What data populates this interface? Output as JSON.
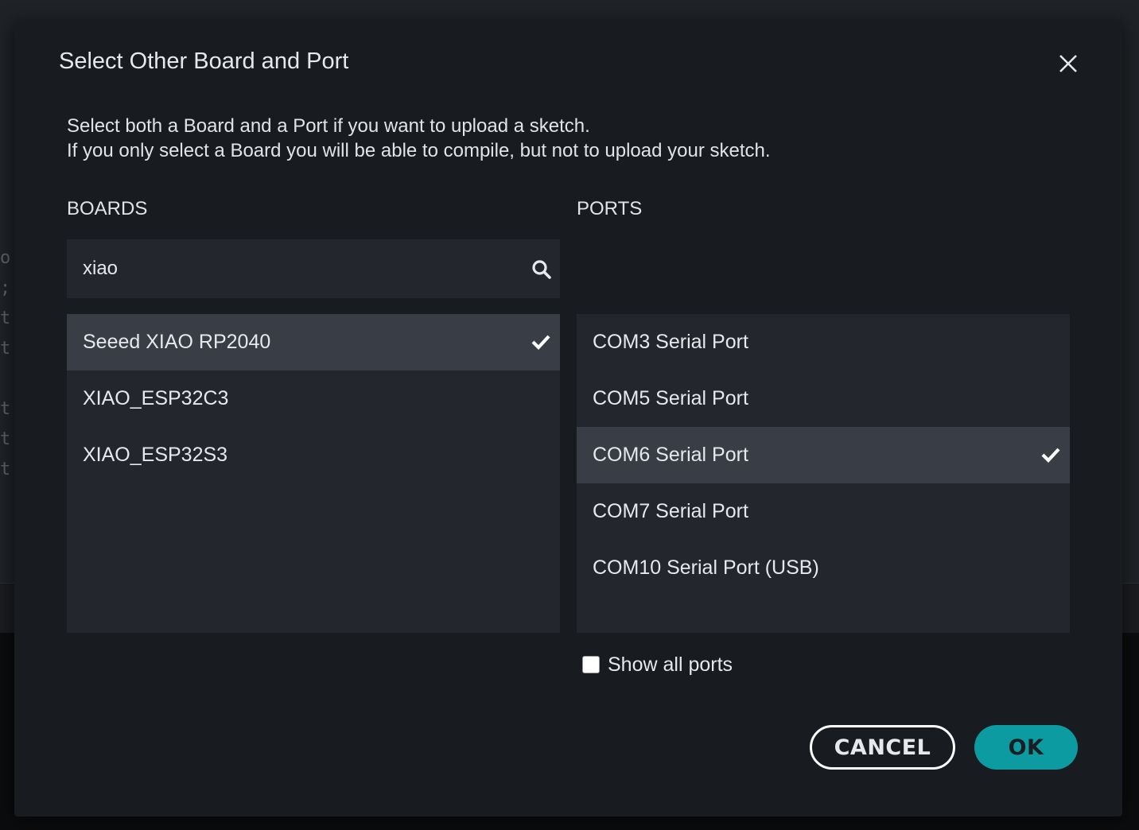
{
  "dialog": {
    "title": "Select Other Board and Port",
    "intro_line1": "Select both a Board and a Port if you want to upload a sketch.",
    "intro_line2": "If you only select a Board you will be able to compile, but not to upload your sketch."
  },
  "boards": {
    "heading": "BOARDS",
    "search_value": "xiao",
    "items": [
      {
        "label": "Seeed XIAO RP2040",
        "selected": true
      },
      {
        "label": "XIAO_ESP32C3",
        "selected": false
      },
      {
        "label": "XIAO_ESP32S3",
        "selected": false
      }
    ]
  },
  "ports": {
    "heading": "PORTS",
    "items": [
      {
        "label": "COM3 Serial Port",
        "selected": false
      },
      {
        "label": "COM5 Serial Port",
        "selected": false
      },
      {
        "label": "COM6 Serial Port",
        "selected": true
      },
      {
        "label": "COM7 Serial Port",
        "selected": false
      },
      {
        "label": "COM10 Serial Port (USB)",
        "selected": false
      }
    ],
    "show_all_label": "Show all ports",
    "show_all_checked": false
  },
  "buttons": {
    "cancel": "CANCEL",
    "ok": "OK"
  },
  "colors": {
    "accent": "#0c9ba1",
    "dialog_bg": "#181b20",
    "list_bg": "#23262c",
    "selected_bg": "#393d46"
  },
  "icons": {
    "close": "close-icon",
    "search": "search-icon",
    "check": "checkmark-icon"
  }
}
